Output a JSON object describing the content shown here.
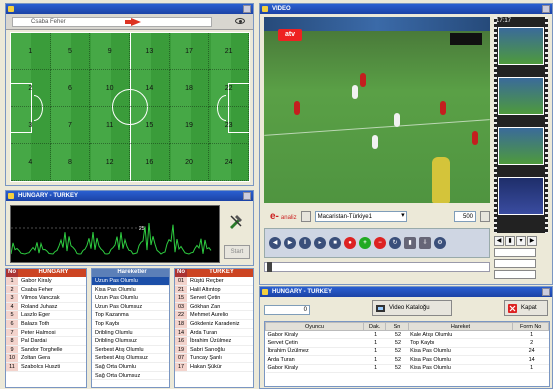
{
  "pitch": {
    "player_name": "Csaba Feher",
    "zones": [
      "1",
      "5",
      "9",
      "13",
      "17",
      "21",
      "2",
      "6",
      "10",
      "14",
      "18",
      "22",
      "3",
      "7",
      "11",
      "15",
      "19",
      "23",
      "4",
      "8",
      "12",
      "16",
      "20",
      "24"
    ]
  },
  "video": {
    "window_title": "VIDEO",
    "channel_logo": "atv",
    "film_counter": "17:17",
    "brand_main": "e-",
    "brand_sub": "analiz",
    "match": "Macaristan-Türkiye1",
    "speed": "500"
  },
  "chart": {
    "window_title": "HUNGARY - TURKEY",
    "peak_value": "25",
    "start_label": "Start"
  },
  "hungary": {
    "header_no": "No",
    "header_name": "HUNGARY",
    "rows": [
      {
        "no": "1",
        "name": "Gabor Kiraly"
      },
      {
        "no": "2",
        "name": "Csaba Feher"
      },
      {
        "no": "3",
        "name": "Vilmos Vanczak"
      },
      {
        "no": "4",
        "name": "Roland Juhasz"
      },
      {
        "no": "5",
        "name": "Laszlo Eger"
      },
      {
        "no": "6",
        "name": "Balazs Toth"
      },
      {
        "no": "7",
        "name": "Peter Halmosi"
      },
      {
        "no": "8",
        "name": "Pal Dardai"
      },
      {
        "no": "9",
        "name": "Sandor Torghelle"
      },
      {
        "no": "10",
        "name": "Zoltan Gera"
      },
      {
        "no": "11",
        "name": "Szabolcs Huszti"
      }
    ]
  },
  "actions": {
    "header": "Hareketler",
    "rows": [
      "Uzun Pas Olumlu",
      "Kisa Pas Olumlu",
      "Uzun Pas Olumlu",
      "Uzun Pas Olumsuz",
      "Top Kazanma",
      "Top Kaybı",
      "Dribling Olumlu",
      "Dribling Olumsuz",
      "Serbest Atış Olumlu",
      "Serbest Atış Olumsuz",
      "Sağ Orta Olumlu",
      "Sağ Orta Olumsuz"
    ],
    "selected": 0
  },
  "turkey": {
    "header_no": "No",
    "header_name": "TURKEY",
    "rows": [
      {
        "no": "01",
        "name": "Rüştü Reçber"
      },
      {
        "no": "21",
        "name": "Halil Altıntop"
      },
      {
        "no": "15",
        "name": "Servet Çetin"
      },
      {
        "no": "03",
        "name": "Gökhan Zan"
      },
      {
        "no": "22",
        "name": "Mehmet Aurelio"
      },
      {
        "no": "18",
        "name": "Gökdeniz Karadeniz"
      },
      {
        "no": "14",
        "name": "Arda Turan"
      },
      {
        "no": "16",
        "name": "İbrahim Üzülmez"
      },
      {
        "no": "19",
        "name": "Sabri Sarıoğlu"
      },
      {
        "no": "07",
        "name": "Tuncay Şanlı"
      },
      {
        "no": "17",
        "name": "Hakan Şükür"
      }
    ]
  },
  "events": {
    "window_title": "HUNGARY - TURKEY",
    "count": "0",
    "catalog_label": "Video Kataloğu",
    "close_label": "Kapat",
    "columns": [
      "Oyuncu",
      "Dak.",
      "Sn",
      "Hareket",
      "Form No"
    ],
    "rows": [
      {
        "player": "Gabor Kiraly",
        "min": "1",
        "sec": "52",
        "action": "Kale Atışı Olumlu",
        "form": "1"
      },
      {
        "player": "Servet Çetin",
        "min": "1",
        "sec": "52",
        "action": "Top Kaybı",
        "form": "2"
      },
      {
        "player": "İbrahim Üzülmez",
        "min": "1",
        "sec": "52",
        "action": "Kisa Pas Olumlu",
        "form": "24"
      },
      {
        "player": "Arda Turan",
        "min": "1",
        "sec": "52",
        "action": "Kisa Pas Olumlu",
        "form": "14"
      },
      {
        "player": "Gabor Kiraly",
        "min": "1",
        "sec": "52",
        "action": "Kisa Pas Olumlu",
        "form": "1"
      }
    ]
  },
  "colors": {
    "titlebar": "#1c43a6",
    "pitch": "#3a9c3a",
    "hungary_header": "#cc4422",
    "selection": "#1c4fa8"
  }
}
